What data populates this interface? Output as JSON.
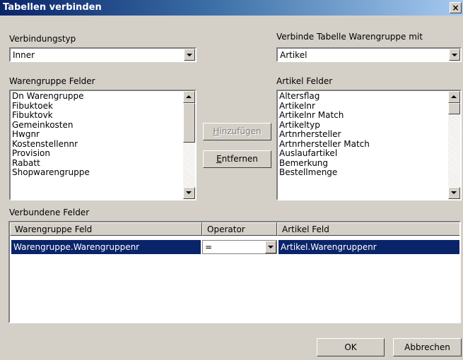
{
  "window": {
    "title": "Tabellen verbinden",
    "close_label": "×"
  },
  "join_type": {
    "label": "Verbindungstyp",
    "value": "Inner"
  },
  "join_table": {
    "label": "Verbinde Tabelle Warengruppe mit",
    "value": "Artikel"
  },
  "left_fields": {
    "label": "Warengruppe Felder",
    "items": [
      "Dn Warengruppe",
      "Fibuktoek",
      "Fibuktovk",
      "Gemeinkosten",
      "Hwgnr",
      "Kostenstellennr",
      "Provision",
      "Rabatt",
      "Shopwarengruppe"
    ]
  },
  "right_fields": {
    "label": "Artikel Felder",
    "items": [
      "Altersflag",
      "Artikelnr",
      "Artikelnr Match",
      "Artikeltyp",
      "Artnrhersteller",
      "Artnrhersteller Match",
      "Auslaufartikel",
      "Bemerkung",
      "Bestellmenge"
    ]
  },
  "buttons": {
    "add_first": "H",
    "add_rest": "inzufügen",
    "remove_first": "E",
    "remove_rest": "ntfernen",
    "ok": "OK",
    "cancel": "Abbrechen"
  },
  "joined": {
    "label": "Verbundene Felder",
    "columns": [
      "Warengruppe Feld",
      "Operator",
      "Artikel Feld"
    ],
    "rows": [
      {
        "left": "Warengruppe.Warengruppenr",
        "operator": "=",
        "right": "Artikel.Warengruppenr"
      }
    ]
  }
}
